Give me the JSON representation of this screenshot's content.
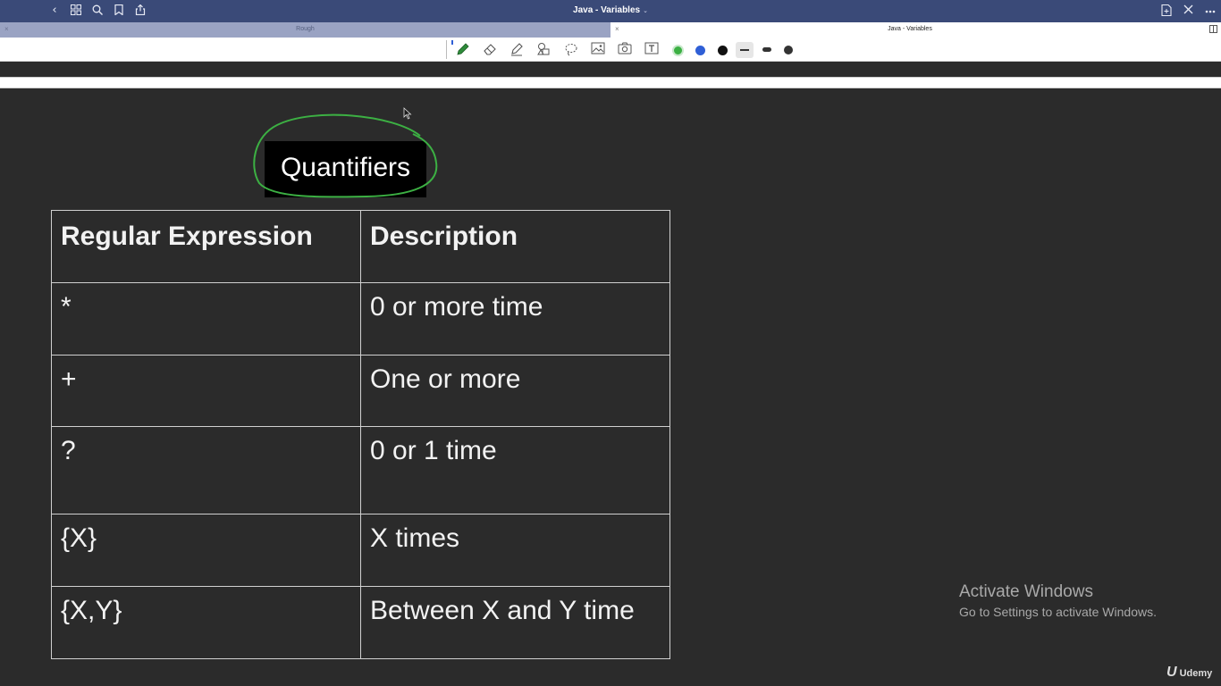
{
  "titlebar": {
    "document_title": "Java - Variables",
    "title_chevron": "⌄",
    "icons": [
      "back-icon",
      "grid-icon",
      "search-icon",
      "bookmark-icon",
      "share-icon",
      "new-page-icon",
      "close-icon",
      "more-icon"
    ]
  },
  "tabs": [
    {
      "label": "Rough",
      "close": "×",
      "active": false
    },
    {
      "label": "Java - Variables",
      "close": "×",
      "active": true
    }
  ],
  "toolbar": {
    "tools": [
      "pen-icon",
      "eraser-icon",
      "highlighter-icon",
      "shapes-icon",
      "lasso-icon",
      "image-icon",
      "camera-icon",
      "text-box-icon"
    ],
    "colors": [
      "#3cb043",
      "#2f5fd6",
      "#111111"
    ],
    "selected_color": "#3cb043",
    "stroke_sizes": [
      "thin",
      "medium",
      "thick"
    ],
    "selected_stroke": "thin"
  },
  "note": {
    "heading": "Quantifiers",
    "highlight_color": "#3cb043",
    "table": {
      "headers": [
        "Regular Expression",
        "Description"
      ],
      "rows": [
        {
          "expr": "*",
          "desc": "0 or more time"
        },
        {
          "expr": "+",
          "desc": "One or more"
        },
        {
          "expr": "?",
          "desc": "0 or 1 time"
        },
        {
          "expr": "{X}",
          "desc": "X times"
        },
        {
          "expr": "{X,Y}",
          "desc": "Between X and Y time"
        }
      ]
    }
  },
  "watermark": {
    "line1": "Activate Windows",
    "line2": "Go to Settings to activate Windows."
  },
  "brand": {
    "mark": "U",
    "name": "Udemy"
  }
}
